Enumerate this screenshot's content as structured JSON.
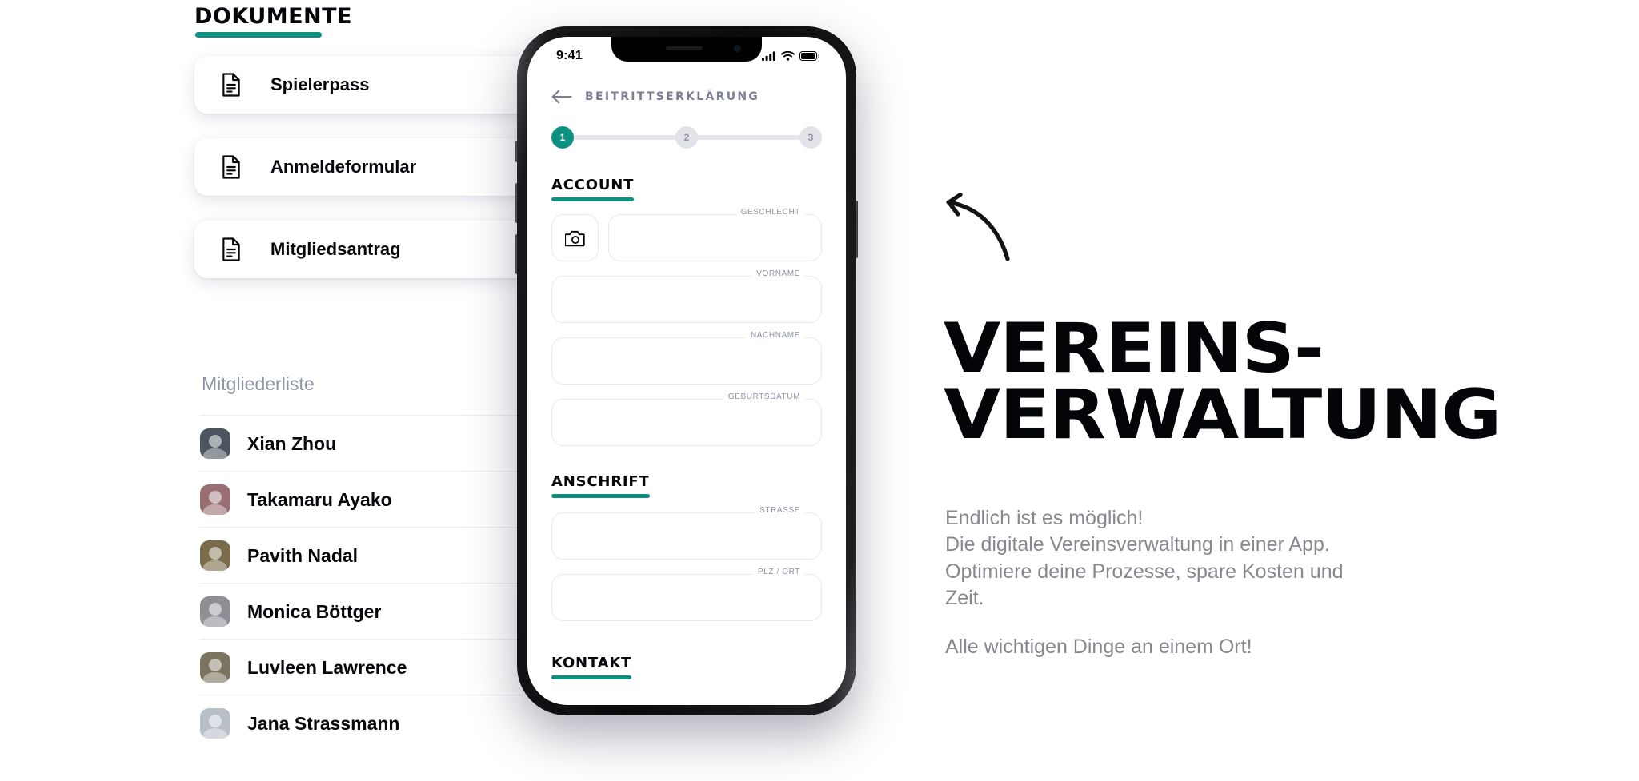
{
  "theme": {
    "accent": "#0c9180",
    "text_dark": "#07080c",
    "text_muted": "#86888f",
    "title_muted": "#7b7f96",
    "field_border": "#e9eaee",
    "step_idle": "#e2e3e9"
  },
  "left_panel": {
    "documents_heading": "DOKUMENTE",
    "documents": [
      {
        "label": "Spielerpass",
        "icon": "document-icon"
      },
      {
        "label": "Anmeldeformular",
        "icon": "document-icon"
      },
      {
        "label": "Mitgliedsantrag",
        "icon": "document-icon"
      }
    ],
    "members_heading": "Mitgliederliste",
    "members": [
      {
        "name": "Xian Zhou",
        "avatar_tone": "#4a5560"
      },
      {
        "name": "Takamaru Ayako",
        "avatar_tone": "#9a6f73"
      },
      {
        "name": "Pavith Nadal",
        "avatar_tone": "#7a6b4a"
      },
      {
        "name": "Monica Böttger",
        "avatar_tone": "#8d8f95"
      },
      {
        "name": "Luvleen Lawrence",
        "avatar_tone": "#7b7460"
      },
      {
        "name": "Jana Strassmann",
        "avatar_tone": "#b9bfc6"
      }
    ]
  },
  "phone": {
    "status_bar": {
      "time": "9:41",
      "icons": [
        "cellular-signal-icon",
        "wifi-icon",
        "battery-icon"
      ]
    },
    "app": {
      "back_icon": "back-arrow-icon",
      "title": "BEITRITTSERKLÄRUNG",
      "stepper": {
        "steps": [
          "1",
          "2",
          "3"
        ],
        "active_index": 0
      },
      "sections": [
        {
          "title": "ACCOUNT",
          "photo_button_icon": "camera-icon",
          "fields": [
            {
              "label": "GESCHLECHT",
              "value": "",
              "inline_with_photo": true
            },
            {
              "label": "VORNAME",
              "value": ""
            },
            {
              "label": "NACHNAME",
              "value": ""
            },
            {
              "label": "GEBURTSDATUM",
              "value": ""
            }
          ]
        },
        {
          "title": "ANSCHRIFT",
          "fields": [
            {
              "label": "STRASSE",
              "value": ""
            },
            {
              "label": "PLZ / ORT",
              "value": ""
            }
          ]
        },
        {
          "title": "KONTAKT",
          "fields": []
        }
      ]
    }
  },
  "right_panel": {
    "arrow_icon": "curved-arrow-icon",
    "headline_lines": [
      "VEREINS-",
      "VERWALTUNG"
    ],
    "subcopy_lines": [
      "Endlich ist es möglich!",
      "Die digitale Vereinsverwaltung in einer App.",
      "Optimiere deine Prozesse, spare Kosten und",
      "Zeit."
    ],
    "subcopy_tagline": "Alle wichtigen Dinge an einem Ort!"
  }
}
